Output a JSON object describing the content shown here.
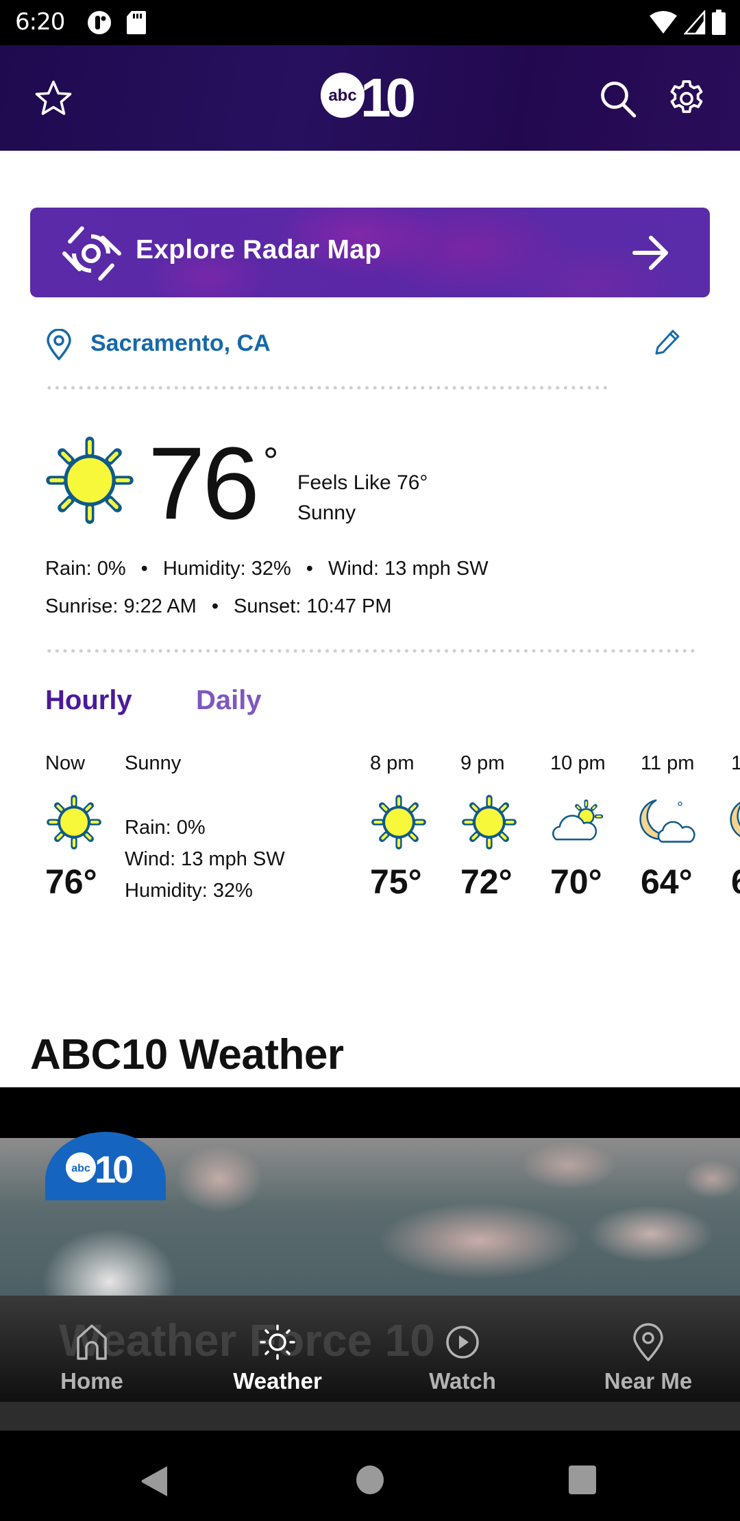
{
  "status_bar": {
    "time": "6:20",
    "left_icons": [
      "notification-dot-icon",
      "sd-card-icon"
    ],
    "right_icons": [
      "wifi-icon",
      "cell-signal-icon",
      "battery-icon"
    ]
  },
  "header": {
    "logo_text": "abc10",
    "logo_abc": "abc",
    "logo_num": "10",
    "left_icon": "star-icon",
    "right_icons": [
      "search-icon",
      "gear-icon"
    ]
  },
  "radar": {
    "label": "Explore Radar Map",
    "icon": "radar-icon",
    "arrow": "arrow-right-icon"
  },
  "location": {
    "name": "Sacramento, CA",
    "icon": "location-pin-icon",
    "edit_icon": "pencil-icon"
  },
  "current": {
    "temp": "76",
    "deg": "°",
    "feels_like": "Feels Like 76°",
    "condition": "Sunny",
    "rain": "Rain: 0%",
    "humidity": "Humidity: 32%",
    "wind": "Wind: 13 mph SW",
    "sunrise": "Sunrise: 9:22 AM",
    "sunset": "Sunset: 10:47 PM",
    "separator": "•"
  },
  "tabs": [
    {
      "label": "Hourly",
      "active": true
    },
    {
      "label": "Daily",
      "active": false
    }
  ],
  "hourly": {
    "now": {
      "label": "Now",
      "condition": "Sunny",
      "temp": "76°",
      "icon": "sun-icon",
      "rain": "Rain: 0%",
      "wind": "Wind: 13 mph SW",
      "humidity": "Humidity: 32%"
    },
    "hours": [
      {
        "label": "8 pm",
        "temp": "75°",
        "icon": "sun-icon"
      },
      {
        "label": "9 pm",
        "temp": "72°",
        "icon": "sun-icon"
      },
      {
        "label": "10 pm",
        "temp": "70°",
        "icon": "partly-cloudy-day-icon"
      },
      {
        "label": "11 pm",
        "temp": "64°",
        "icon": "partly-cloudy-night-icon"
      },
      {
        "label": "1",
        "temp": "6",
        "icon": "partly-cloudy-night-icon"
      }
    ]
  },
  "section": {
    "title": "ABC10 Weather",
    "video_watermark": "Weather Force 10"
  },
  "bottom_nav": [
    {
      "label": "Home",
      "icon": "home-icon",
      "active": false
    },
    {
      "label": "Weather",
      "icon": "sun-outline-icon",
      "active": true
    },
    {
      "label": "Watch",
      "icon": "play-circle-icon",
      "active": false
    },
    {
      "label": "Near Me",
      "icon": "location-pin-icon",
      "active": false
    }
  ],
  "system_nav": [
    "back-icon",
    "home-circle-icon",
    "recents-icon"
  ],
  "colors": {
    "header_bg": "#22094f",
    "radar_bg": "#5a2aa8",
    "location_blue": "#1769a8",
    "tab_active": "#4a1a9a",
    "tab_inactive": "#7e57c2",
    "sun_yellow": "#f8f83a",
    "icon_outline": "#0f5a8c"
  }
}
